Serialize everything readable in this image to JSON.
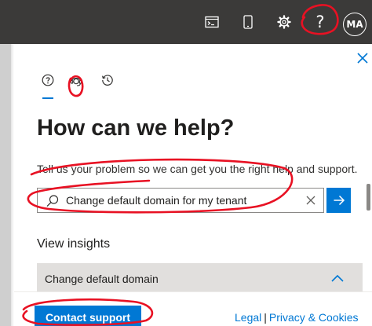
{
  "topbar": {
    "icons": [
      "terminal-icon",
      "mobile-icon",
      "gear-icon",
      "help-icon"
    ],
    "help_glyph": "?",
    "avatar_initials": "MA"
  },
  "panel": {
    "pivots": [
      "help-icon",
      "agent-icon",
      "history-icon"
    ],
    "heading": "How can we help?",
    "helper_text": "Tell us your problem so we can get you the right help and support.",
    "search": {
      "value": "Change default domain for my tenant"
    },
    "insights": {
      "label": "View insights",
      "row_label": "Change default domain"
    }
  },
  "footer": {
    "contact_label": "Contact support",
    "legal_label": "Legal",
    "separator": "|",
    "privacy_label": "Privacy & Cookies"
  },
  "colors": {
    "topbar": "#3b3a39",
    "accent": "#0078d4",
    "annotation": "#e81123",
    "insight_row": "#e1dfdd"
  }
}
